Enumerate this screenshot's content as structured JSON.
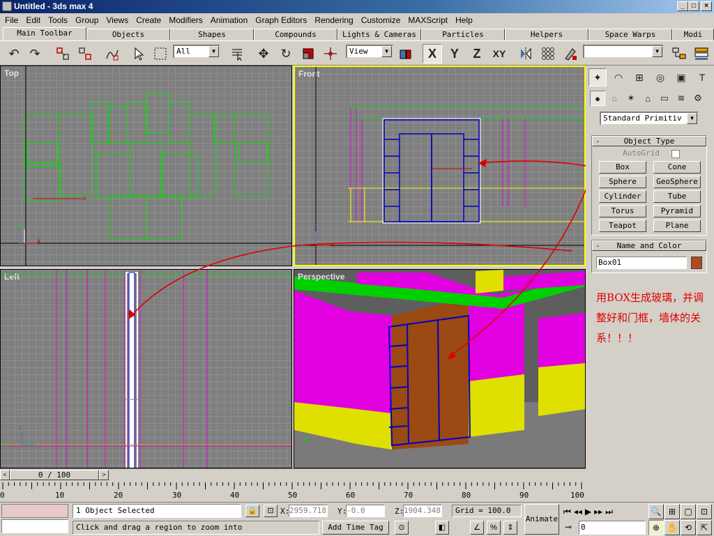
{
  "window": {
    "title": "Untitled - 3ds max 4"
  },
  "menu": [
    "File",
    "Edit",
    "Tools",
    "Group",
    "Views",
    "Create",
    "Modifiers",
    "Animation",
    "Graph Editors",
    "Rendering",
    "Customize",
    "MAXScript",
    "Help"
  ],
  "tabs": [
    "Main Toolbar",
    "Objects",
    "Shapes",
    "Compounds",
    "Lights & Cameras",
    "Particles",
    "Helpers",
    "Space Warps",
    "Modi"
  ],
  "toolbar": {
    "selection_filter": "All",
    "ref_coord": "View",
    "axis_x": "X",
    "axis_y": "Y",
    "axis_z": "Z",
    "axis_xy": "XY"
  },
  "viewports": {
    "top": "Top",
    "front": "Front",
    "left": "Left",
    "perspective": "Perspective",
    "axis_x": "x",
    "axis_y": "y",
    "axis_z": "z"
  },
  "command_panel": {
    "category": "Standard Primitiv",
    "object_type_title": "Object Type",
    "autogrid": "AutoGrid",
    "buttons": [
      "Box",
      "Cone",
      "Sphere",
      "GeoSphere",
      "Cylinder",
      "Tube",
      "Torus",
      "Pyramid",
      "Teapot",
      "Plane"
    ],
    "name_color_title": "Name and Color",
    "object_name": "Box01",
    "object_color": "#b04a1e"
  },
  "annotation": {
    "text": "用BOX生成玻璃，并调整好和门框，墙体的关系！！！",
    "color": "#e00000"
  },
  "timeline": {
    "frame_display": "0 / 100",
    "ticks": [
      "0",
      "10",
      "20",
      "30",
      "40",
      "50",
      "60",
      "70",
      "80",
      "90",
      "100"
    ]
  },
  "status": {
    "selection": "1 Object Selected",
    "prompt": "Click and drag a region to zoom into",
    "x_label": "X:",
    "x_value": "2959.718",
    "y_label": "Y:",
    "y_value": "-0.0",
    "z_label": "Z:",
    "z_value": "1904.348",
    "grid": "Grid = 100.0",
    "add_time_tag": "Add Time Tag",
    "animate": "Animate",
    "current_frame": "0"
  }
}
